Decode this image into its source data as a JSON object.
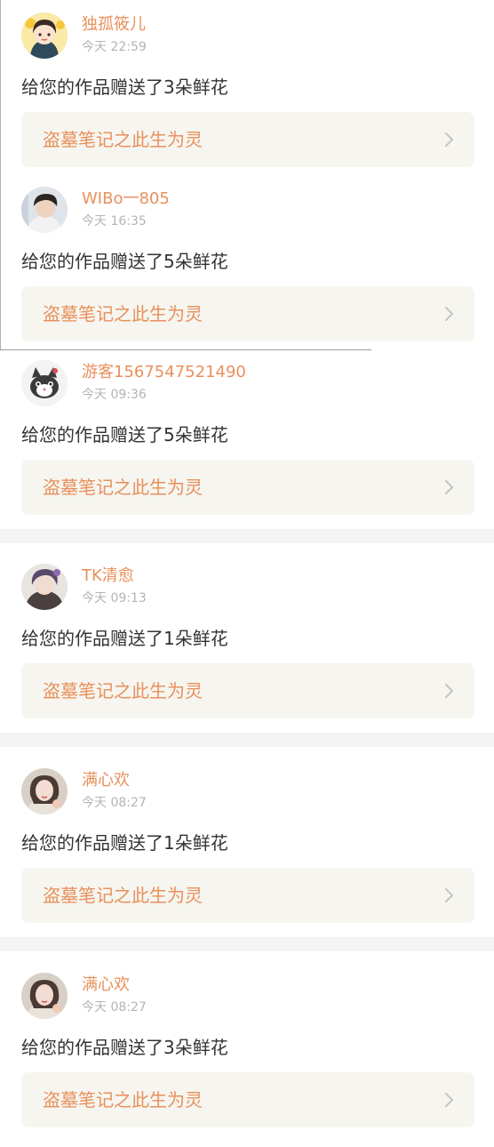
{
  "notifications": [
    {
      "username": "独孤筱儿",
      "time": "今天 22:59",
      "message": "给您的作品赠送了3朵鲜花",
      "work_title": "盗墓笔记之此生为灵",
      "avatar_icon": "cartoon-girl-avatar-icon"
    },
    {
      "username": "WIBo一805",
      "time": "今天 16:35",
      "message": "给您的作品赠送了5朵鲜花",
      "work_title": "盗墓笔记之此生为灵",
      "avatar_icon": "young-man-photo-avatar-icon"
    },
    {
      "username": "游客1567547521490",
      "time": "今天 09:36",
      "message": "给您的作品赠送了5朵鲜花",
      "work_title": "盗墓笔记之此生为灵",
      "avatar_icon": "cartoon-cat-avatar-icon"
    },
    {
      "username": "TK清愈",
      "time": "今天 09:13",
      "message": "给您的作品赠送了1朵鲜花",
      "work_title": "盗墓笔记之此生为灵",
      "avatar_icon": "anime-character-avatar-icon"
    },
    {
      "username": "满心欢",
      "time": "今天 08:27",
      "message": "给您的作品赠送了1朵鲜花",
      "work_title": "盗墓笔记之此生为灵",
      "avatar_icon": "woman-photo-avatar-icon"
    },
    {
      "username": "满心欢",
      "time": "今天 08:27",
      "message": "给您的作品赠送了3朵鲜花",
      "work_title": "盗墓笔记之此生为灵",
      "avatar_icon": "woman-photo-avatar-icon"
    }
  ],
  "colors": {
    "accent": "#e8905c",
    "text": "#333333",
    "muted": "#b4b4b4",
    "card_bg": "#f6f5ef",
    "divider": "#f4f4f4"
  }
}
